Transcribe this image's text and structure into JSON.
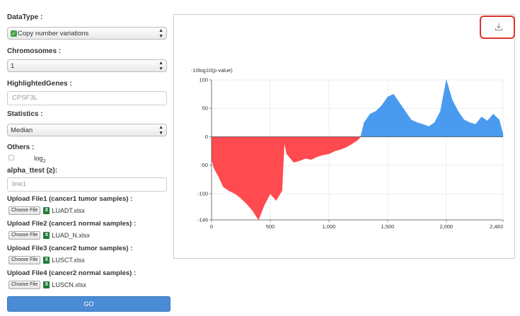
{
  "sidebar": {
    "datatype_label": "DataType :",
    "datatype_value": "Copy number variations",
    "chromosomes_label": "Chromosomes :",
    "chromosomes_value": "1",
    "highlighted_label": "HighlightedGenes :",
    "highlighted_value": "CPSF3L",
    "statistics_label": "Statistics :",
    "statistics_value": "Median",
    "others_label": "Others :",
    "log_text": "log",
    "log_sub": "2",
    "alpha_label": "alpha_ttest (≥):",
    "alpha_placeholder": "line1",
    "choose_file_label": "Choose File",
    "uploads": [
      {
        "label": "Upload File1 (cancer1 tumor samples) :",
        "file": "LUADT.xlsx"
      },
      {
        "label": "Upload File2 (cancer1 normal samples) :",
        "file": "LUAD_N.xlsx"
      },
      {
        "label": "Upload File3 (cancer2 tumor samples) :",
        "file": "LUSCT.xlsx"
      },
      {
        "label": "Upload File4 (cancer2 normal samples) :",
        "file": "LUSCN.xlsx"
      }
    ],
    "go_label": "GO"
  },
  "icons": {
    "check": "check-icon",
    "excel": "excel-file-icon",
    "download": "download-icon"
  },
  "colors": {
    "negative": "#ff4a4f",
    "positive": "#4a9bf0",
    "go_button": "#4a8bd4",
    "highlight_border": "#e0332e"
  },
  "chart_data": {
    "type": "area",
    "ylabel": "-10log10(p-value)",
    "xlabel": "",
    "xlim": [
      0,
      2483
    ],
    "ylim": [
      -146,
      100
    ],
    "xticks": [
      0,
      500,
      1000,
      1500,
      2000,
      2483
    ],
    "xtick_labels": [
      "0",
      "500",
      "1,000",
      "1,500",
      "2,000",
      "2,483"
    ],
    "yticks": [
      -146,
      -100,
      -50,
      0,
      50,
      100
    ],
    "ytick_labels": [
      "-146",
      "-100",
      "-50",
      "0",
      "50",
      "100"
    ],
    "grid": true,
    "series": [
      {
        "color": "#ff4a4f",
        "x": [
          0,
          20,
          60,
          100,
          150,
          200,
          250,
          300,
          350,
          400,
          450,
          500,
          550,
          600,
          620,
          640,
          660,
          700,
          750,
          800,
          850,
          900,
          950,
          1000,
          1050,
          1100,
          1150,
          1200,
          1250,
          1270
        ],
        "y": [
          -40,
          -55,
          -70,
          -88,
          -95,
          -100,
          -108,
          -118,
          -130,
          -146,
          -120,
          -100,
          -112,
          -95,
          -10,
          -30,
          -35,
          -45,
          -42,
          -38,
          -40,
          -35,
          -32,
          -30,
          -25,
          -22,
          -18,
          -12,
          -5,
          0
        ]
      },
      {
        "color": "#4a9bf0",
        "x": [
          1270,
          1300,
          1350,
          1400,
          1450,
          1500,
          1550,
          1600,
          1650,
          1700,
          1750,
          1800,
          1850,
          1900,
          1950,
          2000,
          2050,
          2100,
          2150,
          2200,
          2250,
          2300,
          2350,
          2400,
          2450,
          2483
        ],
        "y": [
          0,
          25,
          40,
          45,
          55,
          70,
          75,
          60,
          45,
          30,
          25,
          22,
          18,
          25,
          45,
          100,
          65,
          45,
          30,
          25,
          22,
          35,
          28,
          40,
          30,
          5
        ]
      }
    ]
  }
}
